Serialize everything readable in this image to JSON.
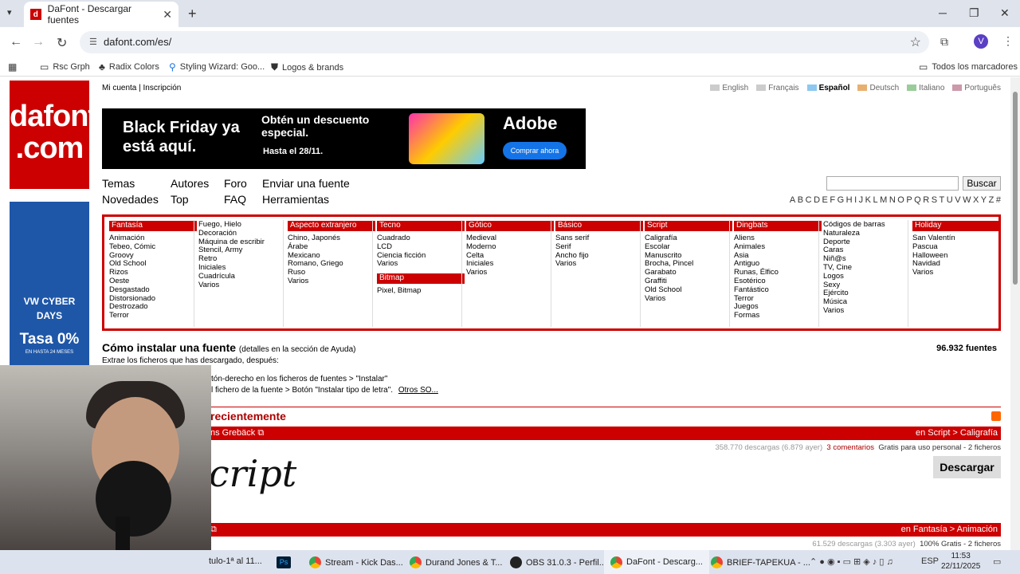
{
  "browser": {
    "tab_title": "DaFont - Descargar fuentes",
    "tab_favicon": "d",
    "tab_close": "✕",
    "new_tab": "+",
    "url": "dafont.com/es/",
    "bookmarks": [
      "Rsc Grph",
      "Radix Colors",
      "Styling Wizard: Goo...",
      "Logos & brands"
    ],
    "all_bookmarks": "Todos los marcadores"
  },
  "site": {
    "logo_line1": "dafont",
    "logo_line2": ".com",
    "account": "Mi cuenta",
    "separator": "|",
    "register": "Inscripción",
    "languages": [
      "English",
      "Français",
      "Español",
      "Deutsch",
      "Italiano",
      "Português"
    ],
    "active_language": "Español",
    "banner": {
      "headline": "Black Friday ya está aquí.",
      "offer": "Obtén un descuento especial.",
      "until": "Hasta el 28/11.",
      "brand": "Adobe",
      "cta": "Comprar ahora"
    },
    "side_ad": {
      "line1": "VW CYBER",
      "line2": "DAYS",
      "line3": "Tasa 0%",
      "line4": "EN HASTA 24 MESES"
    },
    "nav": {
      "themes": "Temas",
      "authors": "Autores",
      "forum": "Foro",
      "submit": "Enviar una fuente",
      "new": "Novedades",
      "top": "Top",
      "faq": "FAQ",
      "tools": "Herramientas"
    },
    "search_button": "Buscar",
    "alphabet": [
      "A",
      "B",
      "C",
      "D",
      "E",
      "F",
      "G",
      "H",
      "I",
      "J",
      "K",
      "L",
      "M",
      "N",
      "O",
      "P",
      "Q",
      "R",
      "S",
      "T",
      "U",
      "V",
      "W",
      "X",
      "Y",
      "Z",
      "#"
    ],
    "categories": [
      {
        "title": "Fantasía",
        "items": [
          "Animación",
          "Tebeo, Cómic",
          "Groovy",
          "Old School",
          "Rizos",
          "Oeste",
          "Desgastado",
          "Distorsionado",
          "Destrozado",
          "Terror"
        ]
      },
      {
        "title": "",
        "items": [
          "Fuego, Hielo",
          "Decoración",
          "Máquina de escribir",
          "Stencil, Army",
          "Retro",
          "Iniciales",
          "Cuadrícula",
          "Varios"
        ]
      },
      {
        "title": "Aspecto extranjero",
        "items": [
          "Chino, Japonés",
          "Árabe",
          "Mexicano",
          "Romano, Griego",
          "Ruso",
          "Varios"
        ]
      },
      {
        "title": "Tecno",
        "items": [
          "Cuadrado",
          "LCD",
          "Ciencia ficción",
          "Varios"
        ],
        "sub_title": "Bitmap",
        "sub_items": [
          "Pixel, Bitmap"
        ]
      },
      {
        "title": "Gótico",
        "items": [
          "Medieval",
          "Moderno",
          "Celta",
          "Iniciales",
          "Varios"
        ]
      },
      {
        "title": "Básico",
        "items": [
          "Sans serif",
          "Serif",
          "Ancho fijo",
          "Varios"
        ]
      },
      {
        "title": "Script",
        "items": [
          "Caligrafía",
          "Escolar",
          "Manuscrito",
          "Brocha, Pincel",
          "Garabato",
          "Graffiti",
          "Old School",
          "Varios"
        ]
      },
      {
        "title": "Dingbats",
        "items": [
          "Aliens",
          "Animales",
          "Asia",
          "Antiguo",
          "Runas, Élfico",
          "Esotérico",
          "Fantástico",
          "Terror",
          "Juegos",
          "Formas"
        ]
      },
      {
        "title": "",
        "items": [
          "Códigos de barras",
          "Naturaleza",
          "Deporte",
          "Caras",
          "Niñ@s",
          "TV, Cine",
          "Logos",
          "Sexy",
          "Ejército",
          "Música",
          "Varios"
        ]
      },
      {
        "title": "Holiday",
        "items": [
          "San Valentín",
          "Pascua",
          "Halloween",
          "Navidad",
          "Varios"
        ]
      }
    ],
    "howto": {
      "title": "Cómo instalar una fuente",
      "detail": "(detalles en la sección de Ayuda)",
      "line1": "Extrae los ficheros que has descargado, después:",
      "line2": "tón-derecho en los ficheros de fuentes > \"Instalar\"",
      "line3": "l fichero de la fuente > Botón \"Instalar tipo de letra\".",
      "more": "Otros SO..."
    },
    "font_count": "96.932 fuentes",
    "recent_title": "recientemente",
    "font1": {
      "author": "ns Grebäck",
      "category": "en Script > Caligrafía",
      "downloads": "358.770 descargas (6.879 ayer)",
      "comments": "3 comentarios",
      "license": "Gratis para uso personal - 2 ficheros",
      "preview": "sia Script",
      "download_button": "Descargar"
    },
    "font2": {
      "category": "en Fantasía > Animación",
      "downloads": "61.529 descargas (3.303 ayer)",
      "license": "100% Gratis - 2 ficheros"
    }
  },
  "taskbar": {
    "items": [
      "tulo-1ª al 11...",
      "Stream - Kick Das...",
      "Durand Jones & T...",
      "OBS 31.0.3 - Perfil...",
      "DaFont - Descarg...",
      "BRIEF-TAPEKUA - ..."
    ],
    "lang": "ESP",
    "time": "11:53",
    "date": "22/11/2025"
  },
  "icons": [
    "menu-chevron-icon",
    "back-icon",
    "forward-icon",
    "reload-icon",
    "site-info-icon",
    "star-icon",
    "extensions-icon",
    "kebab-icon",
    "apps-icon",
    "folder-icon",
    "rss-icon",
    "external-link-icon"
  ]
}
